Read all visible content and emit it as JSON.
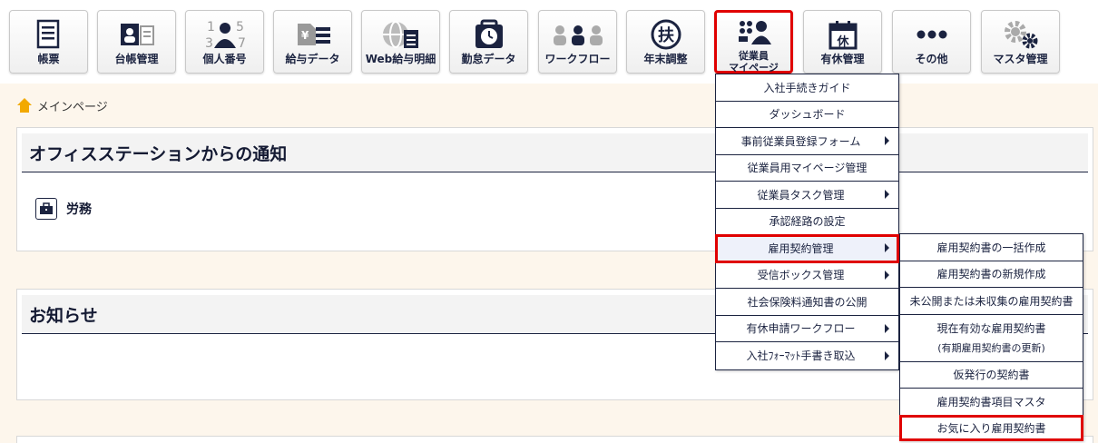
{
  "toolbar": {
    "items": [
      {
        "label": "帳票",
        "icon": "document-icon"
      },
      {
        "label": "台帳管理",
        "icon": "ledger-icon"
      },
      {
        "label": "個人番号",
        "icon": "personal-number-icon"
      },
      {
        "label": "給与データ",
        "icon": "payroll-data-icon"
      },
      {
        "label": "Web給与明細",
        "icon": "web-payslip-icon"
      },
      {
        "label": "勤怠データ",
        "icon": "attendance-icon"
      },
      {
        "label": "ワークフロー",
        "icon": "workflow-icon"
      },
      {
        "label": "年末調整",
        "icon": "year-end-adjustment-icon"
      },
      {
        "label_line1": "従業員",
        "label_line2": "マイページ",
        "icon": "employee-mypage-icon"
      },
      {
        "label": "有休管理",
        "icon": "paid-leave-icon"
      },
      {
        "label": "その他",
        "icon": "more-icon"
      },
      {
        "label": "マスタ管理",
        "icon": "gear-icon"
      }
    ],
    "active_index": 8
  },
  "breadcrumb": {
    "label": "メインページ",
    "icon": "home-icon"
  },
  "panels": {
    "notice": {
      "title": "オフィスステーションからの通知",
      "category": "労務",
      "category_icon": "briefcase-icon"
    },
    "news": {
      "title": "お知らせ"
    }
  },
  "menu": {
    "items": [
      {
        "label": "入社手続きガイド"
      },
      {
        "label": "ダッシュボード"
      },
      {
        "label": "事前従業員登録フォーム"
      },
      {
        "label": "従業員用マイページ管理"
      },
      {
        "label": "従業員タスク管理"
      },
      {
        "label": "承認経路の設定"
      },
      {
        "label": "雇用契約管理"
      },
      {
        "label": "受信ボックス管理"
      },
      {
        "label": "社会保険料通知書の公開"
      },
      {
        "label": "有休申請ワークフロー"
      },
      {
        "label": "入社ﾌｫｰﾏｯﾄ手書き取込"
      }
    ]
  },
  "submenu": {
    "items": [
      {
        "label": "雇用契約書の一括作成"
      },
      {
        "label": "雇用契約書の新規作成"
      },
      {
        "label": "未公開または未収集の雇用契約書"
      },
      {
        "label": "現在有効な雇用契約書",
        "sub": "(有期雇用契約書の更新)"
      },
      {
        "label": "仮発行の契約書"
      },
      {
        "label": "雇用契約書項目マスタ"
      },
      {
        "label": "お気に入り雇用契約書"
      }
    ]
  },
  "colors": {
    "accent": "#1b2340",
    "highlight": "#e00000",
    "background": "#fdf6ec"
  }
}
